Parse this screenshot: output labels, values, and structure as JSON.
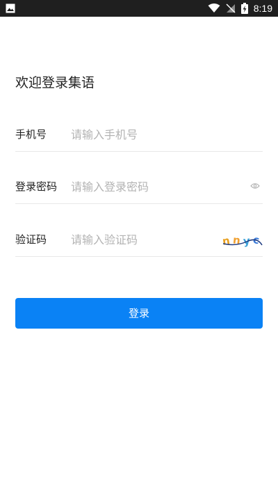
{
  "status_bar": {
    "time": "8:19",
    "icons": [
      "image-icon",
      "wifi-icon",
      "signal-off-icon",
      "battery-charging-icon"
    ]
  },
  "welcome_text": "欢迎登录集语",
  "form": {
    "phone": {
      "label": "手机号",
      "placeholder": "请输入手机号"
    },
    "password": {
      "label": "登录密码",
      "placeholder": "请输入登录密码"
    },
    "captcha": {
      "label": "验证码",
      "placeholder": "请输入验证码",
      "code": "nnyc"
    }
  },
  "login_button": "登录",
  "colors": {
    "accent": "#0a82f5",
    "divider": "#e8e8e8",
    "placeholder": "#b3b3b3"
  }
}
